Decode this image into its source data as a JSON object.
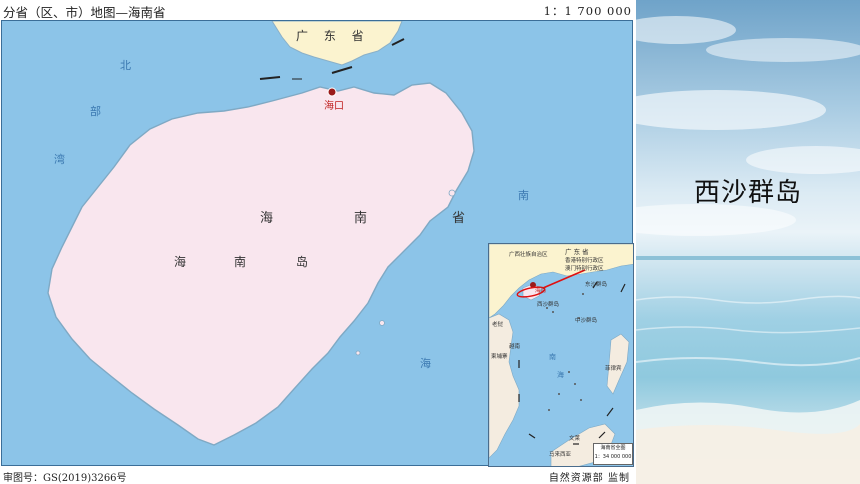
{
  "header": {
    "title": "分省（区、市）地图—海南省",
    "scale": "1：1 700 000"
  },
  "map": {
    "guangdong_label": "广 东 省",
    "haikou_label": "海口",
    "province_chars": [
      "海",
      "南",
      "省"
    ],
    "island_chars": [
      "海",
      "南",
      "岛"
    ],
    "sea_west_chars": [
      "北",
      "部",
      "湾"
    ],
    "sea_east_chars": [
      "南",
      "海"
    ],
    "colors": {
      "sea": "#8cc4e8",
      "island": "#f9e6ee",
      "guangdong": "#fbf3cf",
      "capital": "#9a1a1a"
    }
  },
  "inset": {
    "labels": {
      "guangdong": "广 东 省",
      "guangxi": "广西壮族自治区",
      "hongkong": "香港特别行政区",
      "macau": "澳门特别行政区",
      "hainan": "海南",
      "xisha": "西沙群岛",
      "dongsha": "东沙群岛",
      "zhongsha": "中沙群岛",
      "vietnam": "越南",
      "laos": "老挝",
      "cambodia": "柬埔寨",
      "sea": "南",
      "sea2": "海",
      "philippines": "菲律宾",
      "malaysia": "马来西亚",
      "brunei": "文莱"
    },
    "caption_title": "海南省全图",
    "caption_scale": "1：34 000 000"
  },
  "footer": {
    "review_number": "审图号：GS(2019)3266号",
    "publisher": "自然资源部  监制"
  },
  "photo": {
    "title": "西沙群岛"
  }
}
